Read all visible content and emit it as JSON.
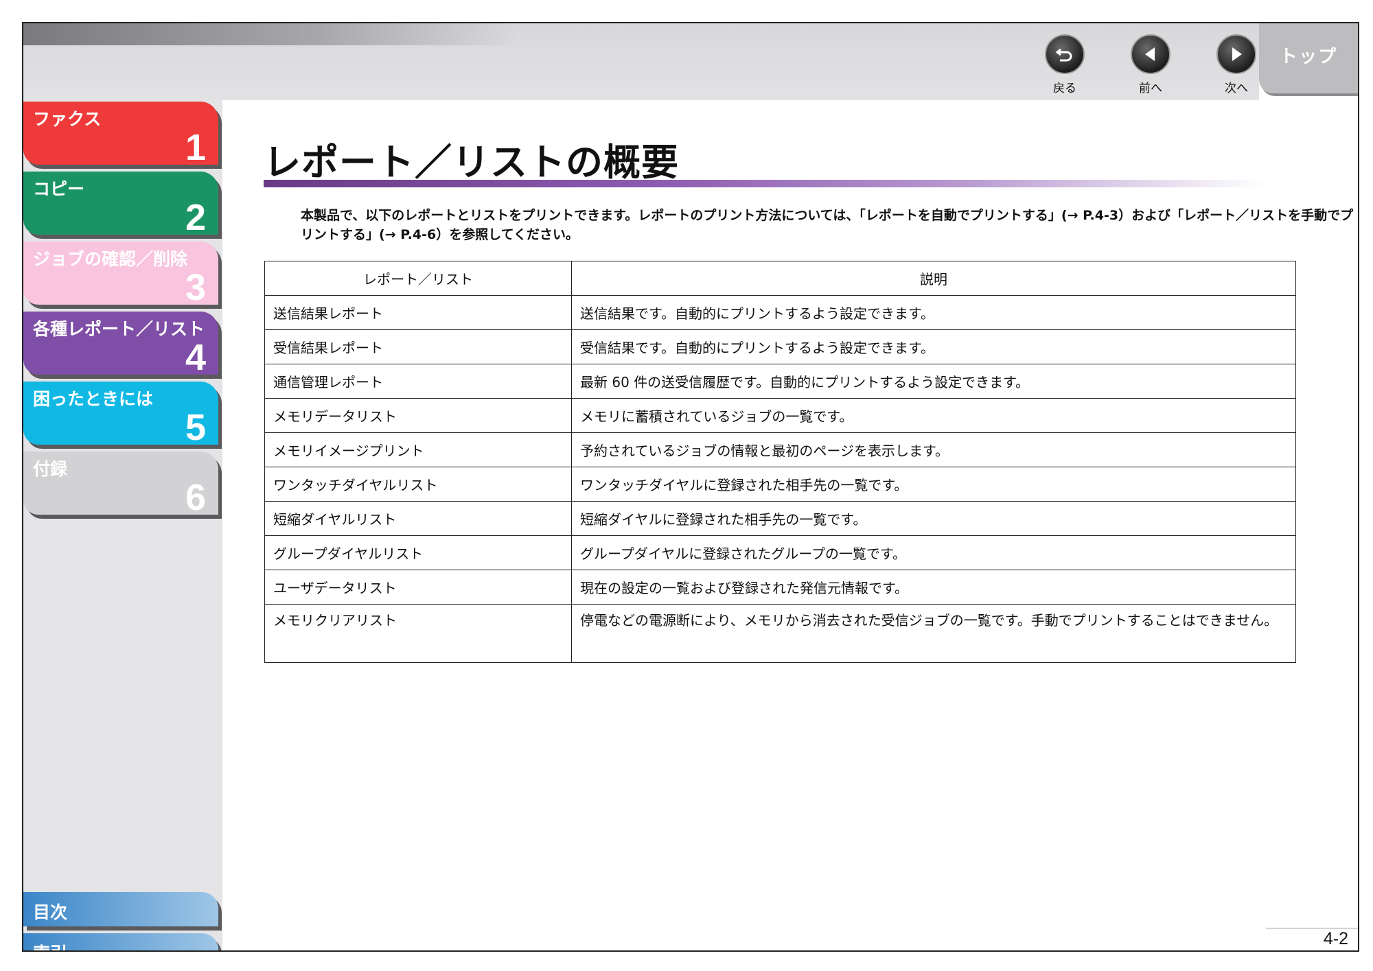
{
  "nav": {
    "back_label": "戻る",
    "prev_label": "前へ",
    "next_label": "次へ",
    "top_label": "トップ"
  },
  "chapters": [
    {
      "title": "ファクス",
      "number": "1",
      "color": "#ee3a3a"
    },
    {
      "title": "コピー",
      "number": "2",
      "color": "#1a9464"
    },
    {
      "title": "ジョブの確認／削除",
      "number": "3",
      "color": "#f8c4de"
    },
    {
      "title": "各種レポート／リスト",
      "number": "4",
      "color": "#7f4ea6"
    },
    {
      "title": "困ったときには",
      "number": "5",
      "color": "#12b8e4"
    },
    {
      "title": "付録",
      "number": "6",
      "color": "#d2d2d4"
    }
  ],
  "sidebar_bottom": {
    "contents_label": "目次",
    "index_label": "索引"
  },
  "page": {
    "title": "レポート／リストの概要",
    "intro": "本製品で、以下のレポートとリストをプリントできます。レポートのプリント方法については、「レポートを自動でプリントする」(→ P.4-3）および「レポート／リストを手動でプリントする」(→ P.4-6）を参照してください。",
    "page_number": "4-2"
  },
  "table": {
    "headers": [
      "レポート／リスト",
      "説明"
    ],
    "rows": [
      [
        "送信結果レポート",
        "送信結果です。自動的にプリントするよう設定できます。"
      ],
      [
        "受信結果レポート",
        "受信結果です。自動的にプリントするよう設定できます。"
      ],
      [
        "通信管理レポート",
        "最新 60 件の送受信履歴です。自動的にプリントするよう設定できます。"
      ],
      [
        "メモリデータリスト",
        "メモリに蓄積されているジョブの一覧です。"
      ],
      [
        "メモリイメージプリント",
        "予約されているジョブの情報と最初のページを表示します。"
      ],
      [
        "ワンタッチダイヤルリスト",
        "ワンタッチダイヤルに登録された相手先の一覧です。"
      ],
      [
        "短縮ダイヤルリスト",
        "短縮ダイヤルに登録された相手先の一覧です。"
      ],
      [
        "グループダイヤルリスト",
        "グループダイヤルに登録されたグループの一覧です。"
      ],
      [
        "ユーザデータリスト",
        "現在の設定の一覧および登録された発信元情報です。"
      ],
      [
        "メモリクリアリスト",
        "停電などの電源断により、メモリから消去された受信ジョブの一覧です。手動でプリントすることはできません。"
      ]
    ]
  }
}
